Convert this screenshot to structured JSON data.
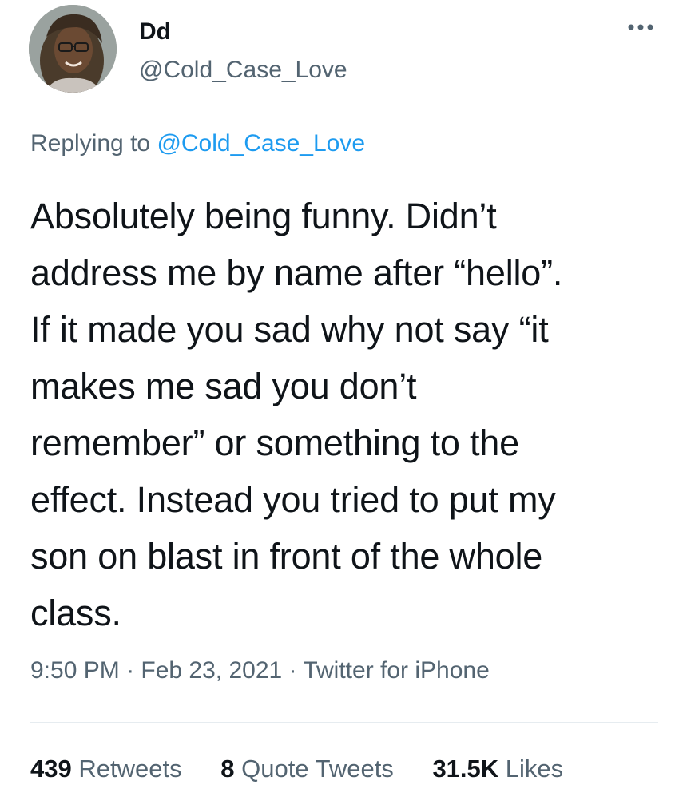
{
  "author": {
    "display_name": "Dd",
    "handle": "@Cold_Case_Love"
  },
  "more_icon": "more-horizontal-icon",
  "reply": {
    "prefix": "Replying to",
    "mention": "@Cold_Case_Love"
  },
  "body_lines": [
    "Absolutely being funny. Didn’t",
    "address me by name after “hello”.",
    "If it made you sad why not say “it",
    "makes me sad you don’t",
    "remember” or something to the",
    "effect. Instead you tried to put my",
    "son on blast in front of the whole",
    "class."
  ],
  "meta": {
    "time": "9:50 PM",
    "sep1": " · ",
    "date": "Feb 23, 2021",
    "sep2": " · ",
    "source": "Twitter for iPhone"
  },
  "stats": {
    "retweets_count": "439",
    "retweets_label": "Retweets",
    "quotes_count": "8",
    "quotes_label": "Quote Tweets",
    "likes_count": "31.5K",
    "likes_label": "Likes"
  },
  "colors": {
    "text": "#0f1419",
    "secondary": "#536471",
    "link": "#1d9bf0"
  }
}
